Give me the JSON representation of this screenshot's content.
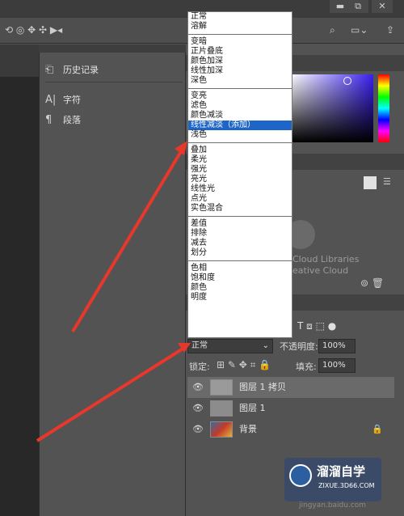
{
  "topbar": {
    "minimize": "▬",
    "restore": "⧉",
    "close": "✕"
  },
  "left_panel": {
    "items": [
      {
        "icon": "history-icon",
        "glyph": "⎗",
        "label": "历史记录"
      },
      {
        "icon": "character-icon",
        "glyph": "A|",
        "label": "字符"
      },
      {
        "icon": "paragraph-icon",
        "glyph": "¶",
        "label": "段落"
      }
    ]
  },
  "blend_modes": [
    [
      "正常",
      "溶解"
    ],
    [
      "变暗",
      "正片叠底",
      "颜色加深",
      "线性加深",
      "深色"
    ],
    [
      "变亮",
      "滤色",
      "颜色减淡",
      "线性减淡（添加）",
      "浅色"
    ],
    [
      "叠加",
      "柔光",
      "强光",
      "亮光",
      "线性光",
      "点光",
      "实色混合"
    ],
    [
      "差值",
      "排除",
      "减去",
      "划分"
    ],
    [
      "色相",
      "饱和度",
      "颜色",
      "明度"
    ]
  ],
  "blend_selected": "线性减淡（添加）",
  "layers_panel": {
    "blend_value": "正常",
    "opacity_label": "不透明度:",
    "opacity_value": "100%",
    "lock_label": "锁定:",
    "fill_label": "填充:",
    "fill_value": "100%",
    "layers": [
      {
        "name": "图层 1 拷贝"
      },
      {
        "name": "图层 1"
      },
      {
        "name": "背景"
      }
    ]
  },
  "libraries": {
    "text1": "Cloud Libraries",
    "text2": "eative Cloud"
  },
  "watermark": {
    "brand": "溜溜自学",
    "url": "ZIXUE.3D66.COM",
    "url2": "jingyan.baidu.com"
  },
  "colors": {
    "selection": "#1e65c8",
    "arrow": "#e8372b"
  }
}
